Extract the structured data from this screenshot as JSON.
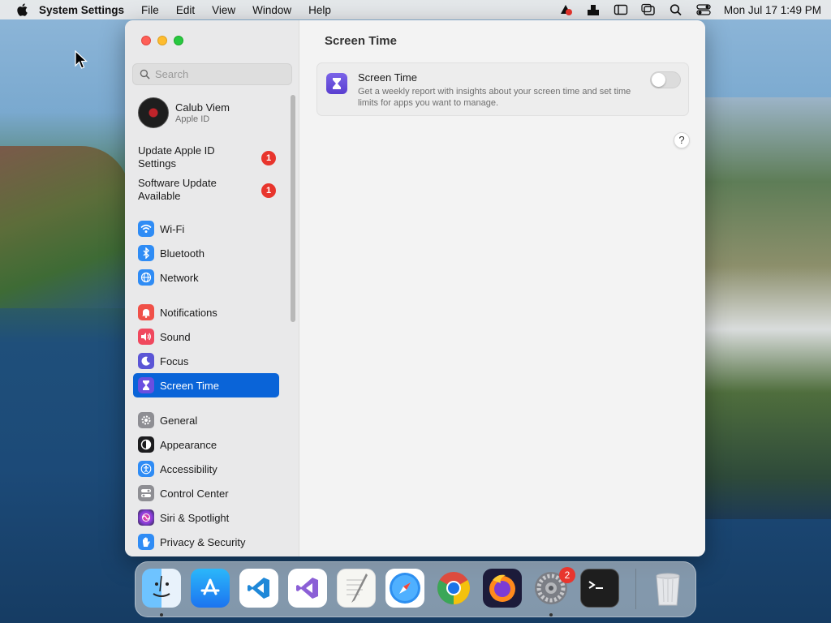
{
  "menubar": {
    "app_name": "System Settings",
    "items": [
      "File",
      "Edit",
      "View",
      "Window",
      "Help"
    ],
    "clock": "Mon Jul 17  1:49 PM"
  },
  "window": {
    "search_placeholder": "Search",
    "user": {
      "name": "Calub Viem",
      "subtitle": "Apple ID"
    },
    "alerts": [
      {
        "label": "Update Apple ID Settings",
        "badge": "1"
      },
      {
        "label": "Software Update Available",
        "badge": "1"
      }
    ],
    "sidebar_items": [
      {
        "label": "Wi-Fi",
        "icon": "wifi-icon",
        "color": "#2f8cf5"
      },
      {
        "label": "Bluetooth",
        "icon": "bluetooth-icon",
        "color": "#2f8cf5"
      },
      {
        "label": "Network",
        "icon": "globe-icon",
        "color": "#2f8cf5"
      },
      {
        "label": "Notifications",
        "icon": "bell-icon",
        "color": "#f05048"
      },
      {
        "label": "Sound",
        "icon": "speaker-icon",
        "color": "#f0485e"
      },
      {
        "label": "Focus",
        "icon": "moon-icon",
        "color": "#5b55d6"
      },
      {
        "label": "Screen Time",
        "icon": "hourglass-icon",
        "color": "#6a4fe0",
        "selected": true
      },
      {
        "label": "General",
        "icon": "gear-icon",
        "color": "#8e8e93"
      },
      {
        "label": "Appearance",
        "icon": "appearance-icon",
        "color": "#1c1c1e"
      },
      {
        "label": "Accessibility",
        "icon": "accessibility-icon",
        "color": "#2f8cf5"
      },
      {
        "label": "Control Center",
        "icon": "switches-icon",
        "color": "#8e8e93"
      },
      {
        "label": "Siri & Spotlight",
        "icon": "siri-icon",
        "color": "#c43bd6"
      },
      {
        "label": "Privacy & Security",
        "icon": "hand-icon",
        "color": "#2f8cf5"
      }
    ],
    "content": {
      "title": "Screen Time",
      "card": {
        "title": "Screen Time",
        "description": "Get a weekly report with insights about your screen time and set time limits for apps you want to manage.",
        "toggle_on": false
      },
      "help_label": "?"
    }
  },
  "dock": {
    "apps": [
      "Finder",
      "App Store",
      "Visual Studio Code",
      "Visual Studio",
      "TextEdit",
      "Safari",
      "Google Chrome",
      "Firefox",
      "System Settings",
      "Terminal",
      "Trash"
    ],
    "settings_badge": "2"
  }
}
